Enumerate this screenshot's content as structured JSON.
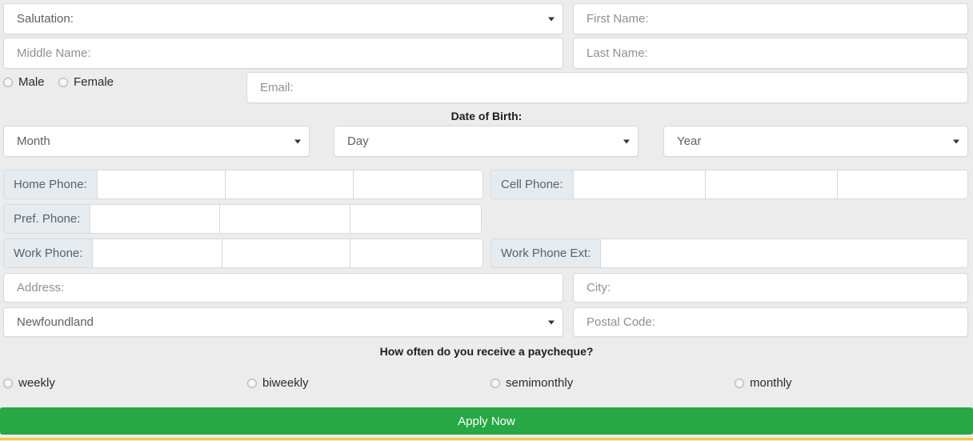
{
  "theme": {
    "page_bg": "#ececec",
    "field_bg": "#ffffff",
    "field_border": "#d8d8d8",
    "placeholder_color": "#8b9197",
    "phone_label_bg": "#e6ebef",
    "apply_green": "#27a844",
    "bottom_strip_yellow": "#f5c842"
  },
  "form": {
    "salutation": {
      "value": "Salutation:",
      "is_select": true
    },
    "first_name": {
      "placeholder": "First Name:"
    },
    "middle_name": {
      "placeholder": "Middle Name:"
    },
    "last_name": {
      "placeholder": "Last Name:"
    },
    "gender": {
      "options": [
        {
          "label": "Male",
          "selected": false
        },
        {
          "label": "Female",
          "selected": false
        }
      ]
    },
    "email": {
      "placeholder": "Email:"
    },
    "date_of_birth": {
      "caption": "Date of Birth:",
      "month": {
        "value": "Month",
        "is_select": true
      },
      "day": {
        "value": "Day",
        "is_select": true
      },
      "year": {
        "value": "Year",
        "is_select": true
      }
    },
    "phones": [
      {
        "label": "Home Phone:",
        "segments": 3
      },
      {
        "label": "Cell Phone:",
        "segments": 3
      },
      {
        "label": "Pref. Phone:",
        "segments": 3
      },
      {
        "label": "Work Phone:",
        "segments": 3
      },
      {
        "label": "Work Phone Ext:",
        "segments": 1
      }
    ],
    "address": {
      "placeholder": "Address:"
    },
    "city": {
      "placeholder": "City:"
    },
    "province": {
      "value": "Newfoundland",
      "is_select": true
    },
    "postal_code": {
      "placeholder": "Postal Code:"
    },
    "paycheque": {
      "caption": "How often do you receive a paycheque?",
      "options": [
        {
          "label": "weekly",
          "selected": false
        },
        {
          "label": "biweekly",
          "selected": false
        },
        {
          "label": "semimonthly",
          "selected": false
        },
        {
          "label": "monthly",
          "selected": false
        }
      ]
    },
    "submit": {
      "label": "Apply Now"
    }
  }
}
